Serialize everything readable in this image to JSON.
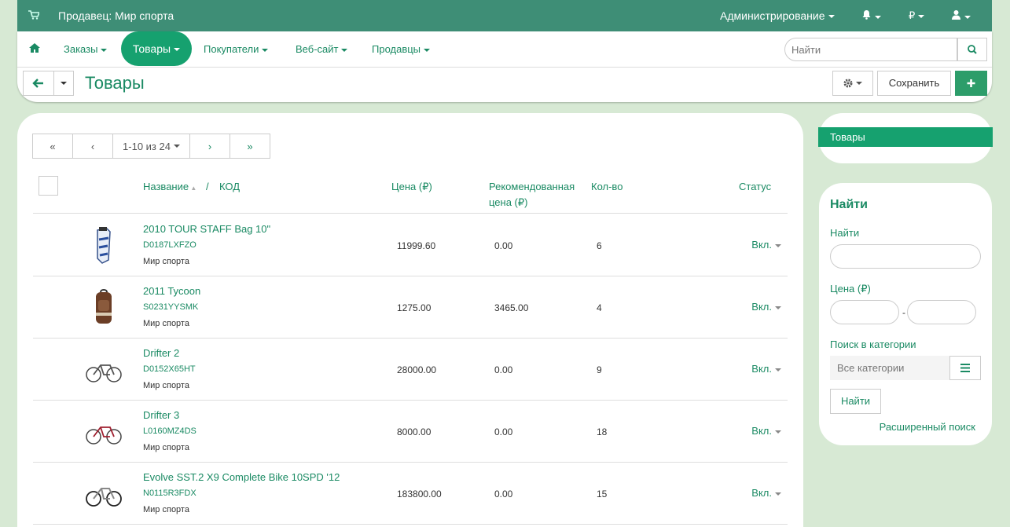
{
  "topbar": {
    "vendor": "Продавец: Мир спорта",
    "admin": "Администрирование",
    "currency": "₽"
  },
  "nav": {
    "items": [
      "Заказы",
      "Товары",
      "Покупатели",
      "Веб-сайт",
      "Продавцы"
    ],
    "search_placeholder": "Найти"
  },
  "toolbar": {
    "title": "Товары",
    "save_label": "Сохранить"
  },
  "pager": {
    "range": "1-10 из 24"
  },
  "table": {
    "headers": {
      "name": "Название",
      "sep": "/",
      "code": "КОД",
      "price": "Цена (₽)",
      "rec": "Рекомендованная цена (₽)",
      "qty": "Кол-во",
      "status": "Статус"
    },
    "rows": [
      {
        "name": "2010 TOUR STAFF Bag 10\"",
        "code": "D0187LXFZO",
        "seller": "Мир спорта",
        "price": "11999.60",
        "rec": "0.00",
        "qty": "6",
        "status": "Вкл."
      },
      {
        "name": "2011 Tycoon",
        "code": "S0231YYSMK",
        "seller": "Мир спорта",
        "price": "1275.00",
        "rec": "3465.00",
        "qty": "4",
        "status": "Вкл."
      },
      {
        "name": "Drifter 2",
        "code": "D0152X65HT",
        "seller": "Мир спорта",
        "price": "28000.00",
        "rec": "0.00",
        "qty": "9",
        "status": "Вкл."
      },
      {
        "name": "Drifter 3",
        "code": "L0160MZ4DS",
        "seller": "Мир спорта",
        "price": "8000.00",
        "rec": "0.00",
        "qty": "18",
        "status": "Вкл."
      },
      {
        "name": "Evolve SST.2 X9 Complete Bike 10SPD '12",
        "code": "N0115R3FDX",
        "seller": "Мир спорта",
        "price": "183800.00",
        "rec": "0.00",
        "qty": "15",
        "status": "Вкл."
      }
    ]
  },
  "sidebar": {
    "active_item": "Товары",
    "search_title": "Найти",
    "find_label": "Найти",
    "price_label": "Цена (₽)",
    "price_sep": "-",
    "category_label": "Поиск в категории",
    "category_value": "Все категории",
    "find_button": "Найти",
    "advanced_link": "Расширенный поиск"
  }
}
